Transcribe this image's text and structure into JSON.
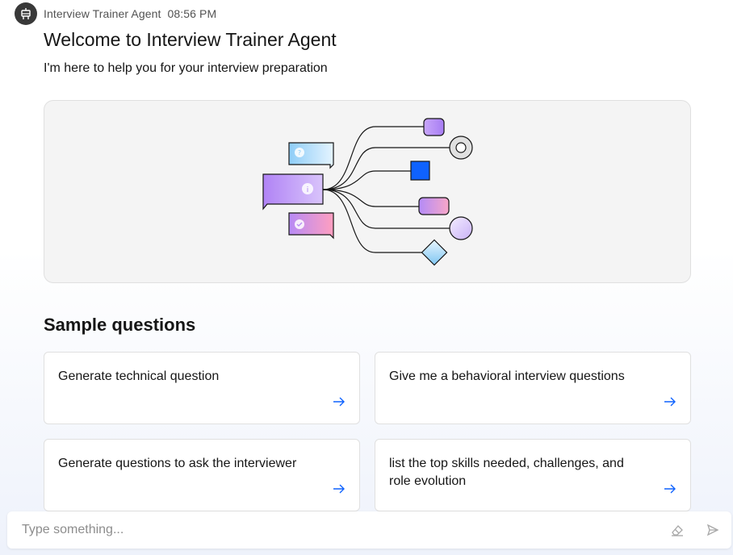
{
  "agent": {
    "name": "Interview Trainer Agent",
    "time": "08:56 PM",
    "avatar_icon": "robot-icon"
  },
  "welcome": {
    "title": "Welcome to Interview Trainer Agent",
    "subtitle": "I'm here to help you for your interview preparation"
  },
  "samples": {
    "heading": "Sample questions",
    "items": [
      {
        "label": "Generate technical question"
      },
      {
        "label": "Give me a behavioral interview questions"
      },
      {
        "label": "Generate questions to ask the interviewer"
      },
      {
        "label": "list the top skills needed, challenges, and role evolution"
      }
    ]
  },
  "composer": {
    "placeholder": "Type something...",
    "clear_icon": "eraser-icon",
    "send_icon": "send-icon"
  },
  "colors": {
    "accent": "#0f62fe",
    "text": "#161616",
    "muted": "#525252"
  }
}
